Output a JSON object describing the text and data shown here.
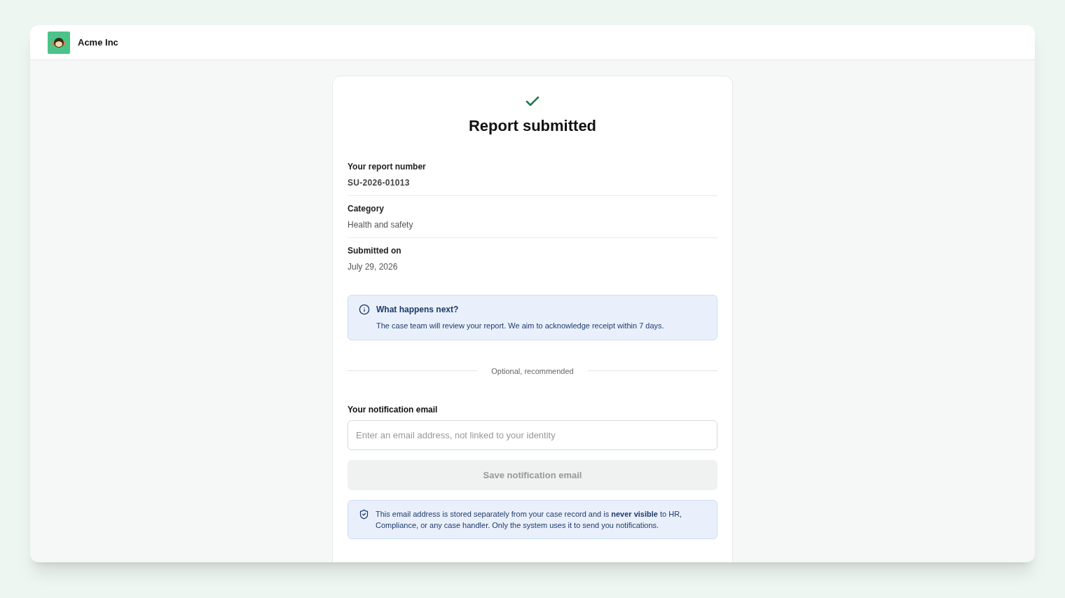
{
  "header": {
    "org_name": "Acme Inc"
  },
  "confirmation": {
    "title": "Report submitted"
  },
  "details": [
    {
      "label": "Your report number",
      "value": "SU-2026-01013",
      "kind": "code"
    },
    {
      "label": "Category",
      "value": "Health and safety",
      "kind": "text"
    },
    {
      "label": "Submitted on",
      "value": "July 29, 2026",
      "kind": "text"
    }
  ],
  "info_notice": {
    "title": "What happens next?",
    "text": "The case team will review your report. We aim to acknowledge receipt within 7 days."
  },
  "divider_label": "Optional, recommended",
  "email_field": {
    "label": "Your notification email",
    "placeholder": "Enter an email address, not linked to your identity"
  },
  "save_button": {
    "label": "Save notification email",
    "disabled": true
  },
  "privacy_notice": {
    "text": "This email address is stored separately from your case record and is **never visible** to HR, Compliance, or any case handler. Only the system uses it to send you notifications."
  }
}
